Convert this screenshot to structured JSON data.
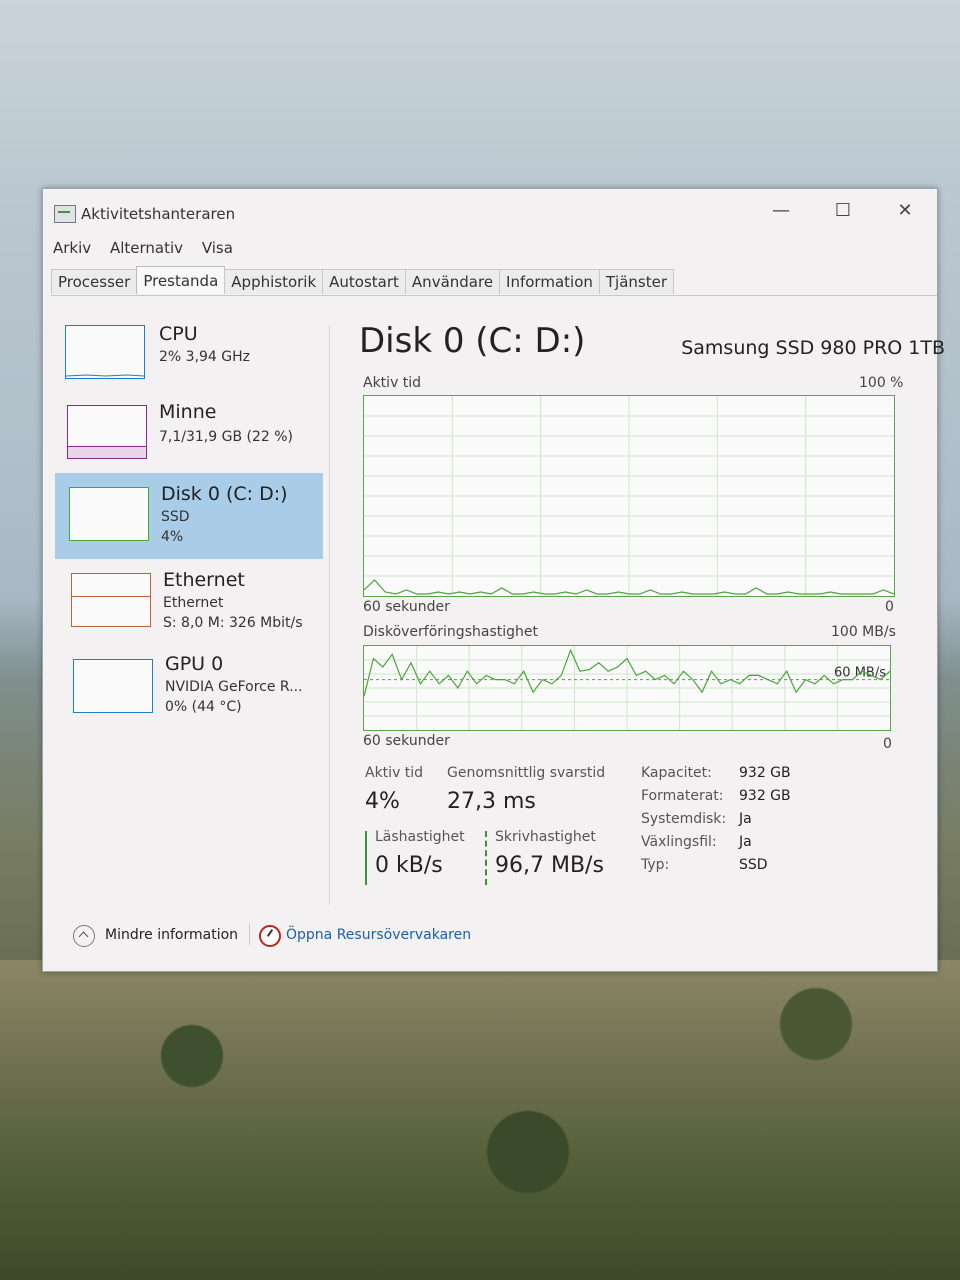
{
  "window": {
    "title": "Aktivitetshanteraren",
    "controls": {
      "minimize": "—",
      "maximize": "☐",
      "close": "✕"
    }
  },
  "menu": [
    "Arkiv",
    "Alternativ",
    "Visa"
  ],
  "tabs": [
    "Processer",
    "Prestanda",
    "Apphistorik",
    "Autostart",
    "Användare",
    "Information",
    "Tjänster"
  ],
  "active_tab": "Prestanda",
  "resources": [
    {
      "name": "CPU",
      "line1": "2% 3,94 GHz",
      "line2": "",
      "color": "#1e7fc6"
    },
    {
      "name": "Minne",
      "line1": "7,1/31,9 GB (22 %)",
      "line2": "",
      "color": "#8b2b8f"
    },
    {
      "name": "Disk 0 (C: D:)",
      "line1": "SSD",
      "line2": "4%",
      "color": "#4aa53a"
    },
    {
      "name": "Ethernet",
      "line1": "Ethernet",
      "line2": "S: 8,0 M: 326 Mbit/s",
      "color": "#b9633f"
    },
    {
      "name": "GPU 0",
      "line1": "NVIDIA GeForce R...",
      "line2": "0% (44 °C)",
      "color": "#1e7fc6"
    }
  ],
  "detail": {
    "title": "Disk 0 (C: D:)",
    "model": "Samsung SSD 980 PRO 1TB",
    "graph1": {
      "label": "Aktiv tid",
      "max": "100 %",
      "time": "60 sekunder",
      "min": "0"
    },
    "graph2": {
      "label": "Diskoverforingshastighet",
      "label_display": "Disköverföringshastighet",
      "max": "100 MB/s",
      "ref": "60 MB/s",
      "time": "60 sekunder",
      "min": "0"
    },
    "stats": {
      "active_label": "Aktiv tid",
      "active_value": "4%",
      "resp_label": "Genomsnittlig svarstid",
      "resp_value": "27,3 ms",
      "read_label": "Läshastighet",
      "read_value": "0 kB/s",
      "write_label": "Skrivhastighet",
      "write_value": "96,7 MB/s"
    },
    "properties": [
      {
        "key": "Kapacitet:",
        "value": "932 GB"
      },
      {
        "key": "Formaterat:",
        "value": "932 GB"
      },
      {
        "key": "Systemdisk:",
        "value": "Ja"
      },
      {
        "key": "Växlingsfil:",
        "value": "Ja"
      },
      {
        "key": "Typ:",
        "value": "SSD"
      }
    ]
  },
  "footer": {
    "less_info": "Mindre information",
    "open_resmon": "Öppna Resursövervakaren"
  },
  "colors": {
    "disk_green": "#4aa53a",
    "selected_bg": "#a9cde8",
    "link_blue": "#1a5fb4"
  },
  "chart_data": [
    {
      "type": "line",
      "title": "Aktiv tid",
      "ylim": [
        0,
        100
      ],
      "unit": "%",
      "x_range": [
        60,
        0
      ],
      "values": [
        3,
        8,
        2,
        1,
        3,
        1,
        1,
        2,
        1,
        2,
        1,
        2,
        1,
        4,
        1,
        1,
        2,
        1,
        1,
        2,
        1,
        3,
        1,
        1,
        2,
        1,
        1,
        3,
        1,
        1,
        2,
        1,
        1,
        1,
        2,
        1,
        1,
        4,
        1,
        1,
        2,
        1,
        1,
        1,
        2,
        1,
        1,
        1,
        1,
        3,
        1
      ]
    },
    {
      "type": "line",
      "title": "Disköverföringshastighet",
      "ylim": [
        0,
        100
      ],
      "unit": "MB/s",
      "reference_line": 60,
      "x_range": [
        60,
        0
      ],
      "values": [
        40,
        85,
        75,
        90,
        60,
        80,
        55,
        70,
        55,
        65,
        50,
        70,
        55,
        65,
        60,
        60,
        55,
        70,
        45,
        60,
        55,
        65,
        95,
        70,
        72,
        80,
        70,
        75,
        85,
        65,
        70,
        60,
        65,
        55,
        70,
        60,
        45,
        70,
        55,
        60,
        55,
        65,
        65,
        60,
        55,
        70,
        45,
        60,
        55,
        65,
        55,
        60,
        60,
        70,
        65,
        60,
        70
      ]
    }
  ]
}
